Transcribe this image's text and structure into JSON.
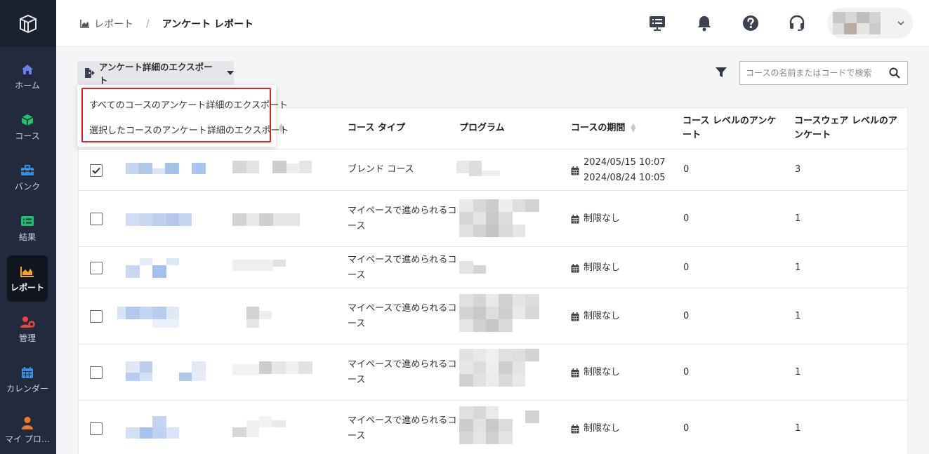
{
  "sidebar": {
    "items": [
      {
        "label": "ホーム",
        "icon": "home-icon",
        "color": "#6c7ef6"
      },
      {
        "label": "コース",
        "icon": "cube-icon",
        "color": "#22c06e"
      },
      {
        "label": "バンク",
        "icon": "toolbox-icon",
        "color": "#3b8de0"
      },
      {
        "label": "結果",
        "icon": "list-icon",
        "color": "#22c06e"
      },
      {
        "label": "レポート",
        "icon": "chart-area-icon",
        "color": "#f5a623"
      },
      {
        "label": "管理",
        "icon": "users-cog-icon",
        "color": "#e8453c"
      },
      {
        "label": "カレンダー",
        "icon": "calendar-icon",
        "color": "#3b8de0"
      },
      {
        "label": "マイ プロ…",
        "icon": "user-icon",
        "color": "#f07a2a"
      }
    ]
  },
  "header": {
    "breadcrumb": {
      "parent": "レポート",
      "current": "アンケート レポート"
    }
  },
  "toolbar": {
    "export_label": "アンケート詳細のエクスポート",
    "search_placeholder": "コースの名前またはコードで検索"
  },
  "dropdown": {
    "items": [
      "すべてのコースのアンケート詳細のエクスポート",
      "選択したコースのアンケート詳細のエクスポート"
    ]
  },
  "table": {
    "headers": {
      "course_type": "コース タイプ",
      "program": "プログラム",
      "period": "コースの期間",
      "course_survey": [
        "コース レベルのアンケ",
        "ート"
      ],
      "courseware_survey": [
        "コースウェア レベルのア",
        "ンケート"
      ]
    },
    "rows": [
      {
        "checked": true,
        "type": [
          "ブレンド コース"
        ],
        "period": [
          "2024/05/15 10:07",
          "2024/08/24 10:05"
        ],
        "course_survey": "0",
        "courseware_survey": "3"
      },
      {
        "checked": false,
        "type": [
          "マイペースで進められるコ",
          "ース"
        ],
        "period": [
          "制限なし"
        ],
        "course_survey": "0",
        "courseware_survey": "1"
      },
      {
        "checked": false,
        "type": [
          "マイペースで進められるコ",
          "ース"
        ],
        "period": [
          "制限なし"
        ],
        "course_survey": "0",
        "courseware_survey": "1"
      },
      {
        "checked": false,
        "type": [
          "マイペースで進められるコ",
          "ース"
        ],
        "period": [
          "制限なし"
        ],
        "course_survey": "0",
        "courseware_survey": "1"
      },
      {
        "checked": false,
        "type": [
          "マイペースで進められるコ",
          "ース"
        ],
        "period": [
          "制限なし"
        ],
        "course_survey": "0",
        "courseware_survey": "1"
      },
      {
        "checked": false,
        "type": [
          "マイペースで進められるコ",
          "ース"
        ],
        "period": [
          "制限なし"
        ],
        "course_survey": "0",
        "courseware_survey": "1"
      }
    ]
  }
}
